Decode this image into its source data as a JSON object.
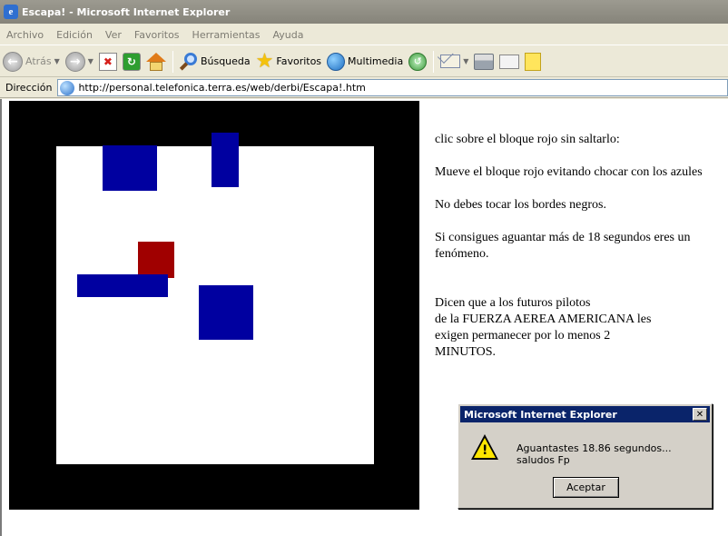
{
  "window": {
    "title": "Escapa! - Microsoft Internet Explorer"
  },
  "menu": [
    "Archivo",
    "Edición",
    "Ver",
    "Favoritos",
    "Herramientas",
    "Ayuda"
  ],
  "toolbar": {
    "back_label": "Atrás",
    "search_label": "Búsqueda",
    "favorites_label": "Favoritos",
    "media_label": "Multimedia"
  },
  "address": {
    "label": "Dirección",
    "url": "http://personal.telefonica.terra.es/web/derbi/Escapa!.htm"
  },
  "page": {
    "line1": "clic sobre el bloque rojo sin saltarlo:",
    "line2": "Mueve el bloque rojo evitando chocar con los azules",
    "line3": "No debes tocar los bordes negros.",
    "line4": "Si consigues aguantar más de 18 segundos eres un fenómeno.",
    "line5a": "Dicen que a los futuros pilotos",
    "line5b": "de la FUERZA AEREA AMERICANA les",
    "line5c": "exigen permanecer por lo menos 2",
    "line5d": "MINUTOS."
  },
  "dialog": {
    "title": "Microsoft Internet Explorer",
    "message": "Aguantastes 18.86 segundos... saludos Fp",
    "ok_label": "Aceptar"
  },
  "colors": {
    "board_border": "#000000",
    "blue_block": "#0000a0",
    "red_block": "#a00000"
  }
}
